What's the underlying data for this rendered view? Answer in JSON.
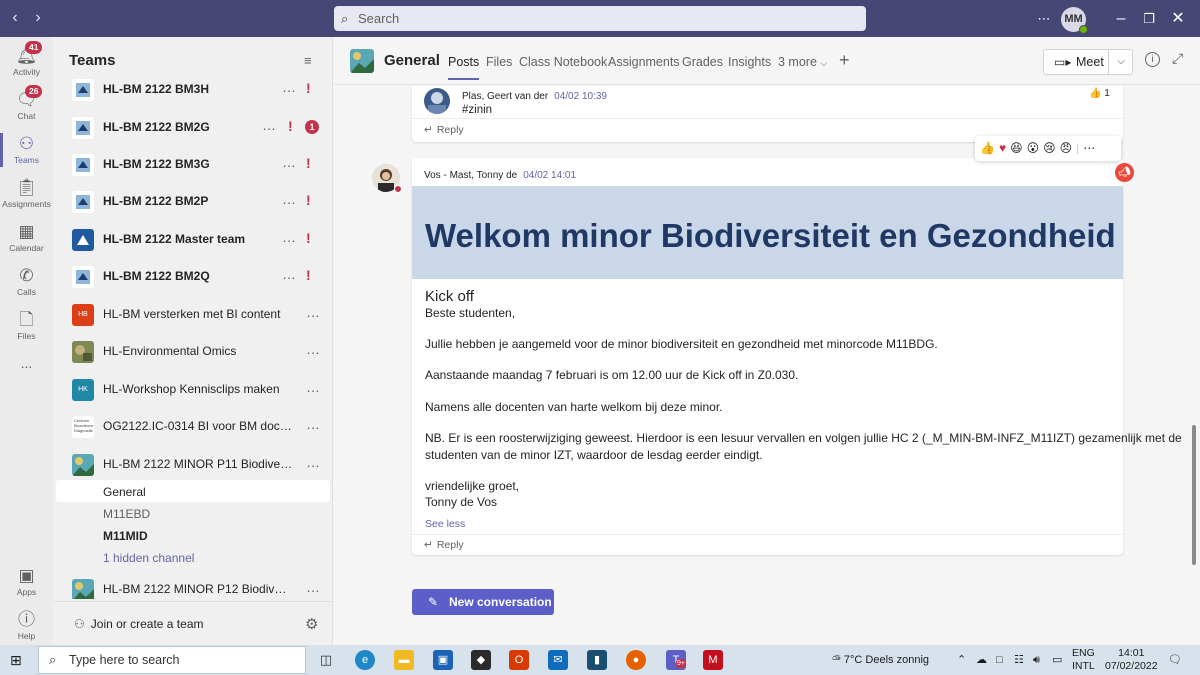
{
  "search": {
    "placeholder": "Search"
  },
  "user": {
    "initials": "MM"
  },
  "rail": {
    "activity": {
      "label": "Activity",
      "badge": "41"
    },
    "chat": {
      "label": "Chat",
      "badge": "26"
    },
    "teams": {
      "label": "Teams"
    },
    "assignments": {
      "label": "Assignments"
    },
    "calendar": {
      "label": "Calendar"
    },
    "calls": {
      "label": "Calls"
    },
    "files": {
      "label": "Files"
    },
    "more": {
      "label": "..."
    },
    "apps": {
      "label": "Apps"
    },
    "help": {
      "label": "Help"
    }
  },
  "panel": {
    "title": "Teams",
    "teams": [
      {
        "name": "HL-BM 2122 BM3H",
        "bold": true
      },
      {
        "name": "HL-BM 2122 BM2G",
        "bold": true,
        "count": "1"
      },
      {
        "name": "HL-BM 2122 BM3G",
        "bold": true
      },
      {
        "name": "HL-BM 2122 BM2P",
        "bold": true
      },
      {
        "name": "HL-BM 2122 Master team",
        "bold": true
      },
      {
        "name": "HL-BM 2122 BM2Q",
        "bold": true
      },
      {
        "name": "HL-BM versterken met BI content",
        "logo_text": "HB"
      },
      {
        "name": "HL-Environmental Omics"
      },
      {
        "name": "HL-Workshop Kennisclips maken",
        "logo_text": "HK"
      },
      {
        "name": "OG2122.IC-0314 BI voor BM docenten",
        "logo_text": "Centrum Bioscience Diagnostik"
      },
      {
        "name": "HL-BM 2122 MINOR P11 Biodiversite..."
      },
      {
        "name": "HL-BM 2122 MINOR P12 Biodiversite..."
      }
    ],
    "channels": [
      "General",
      "M11EBD",
      "M11MID"
    ],
    "hidden_channels": "1 hidden channel",
    "join_label": "Join or create a team"
  },
  "header": {
    "channel": "General",
    "tabs": [
      "Posts",
      "Files",
      "Class Notebook",
      "Assignments",
      "Grades",
      "Insights",
      "3 more"
    ],
    "meet_label": "Meet"
  },
  "posts": {
    "reply1": {
      "author": "Plas, Geert van der",
      "time": "04/02 10:39",
      "text": "#zinin",
      "likes": "1",
      "reply_label": "Reply"
    },
    "main": {
      "author": "Vos - Mast, Tonny de",
      "time": "04/02 14:01",
      "banner": "Welkom minor Biodiversiteit en Gezondheid",
      "heading": "Kick off",
      "greeting": "Beste studenten,",
      "p1": "Jullie hebben je aangemeld voor de minor biodiversiteit en gezondheid met minorcode M11BDG.",
      "p2": "Aanstaande maandag 7 februari is om 12.00 uur de Kick off in Z0.030.",
      "p3": "Namens alle docenten van harte welkom bij deze minor.",
      "p4a": "NB. Er is een roosterwijziging geweest. Hierdoor is een lesuur vervallen en volgen jullie HC 2 (_M_MIN-BM-INFZ_M11IZT) gezamenlijk met de",
      "p4b": "studenten van de minor IZT, waardoor de lesdag eerder eindigt.",
      "closing": "vriendelijke groet,",
      "signature": "Tonny de Vos",
      "see_less": "See less",
      "reply_label": "Reply"
    },
    "new_conversation": "New conversation"
  },
  "taskbar": {
    "search_placeholder": "Type here to search",
    "weather_temp": "7°C",
    "weather_text": "Deels zonnig",
    "lang1": "ENG",
    "lang2": "INTL",
    "time": "14:01",
    "date": "07/02/2022",
    "teams_badge": "9+"
  }
}
